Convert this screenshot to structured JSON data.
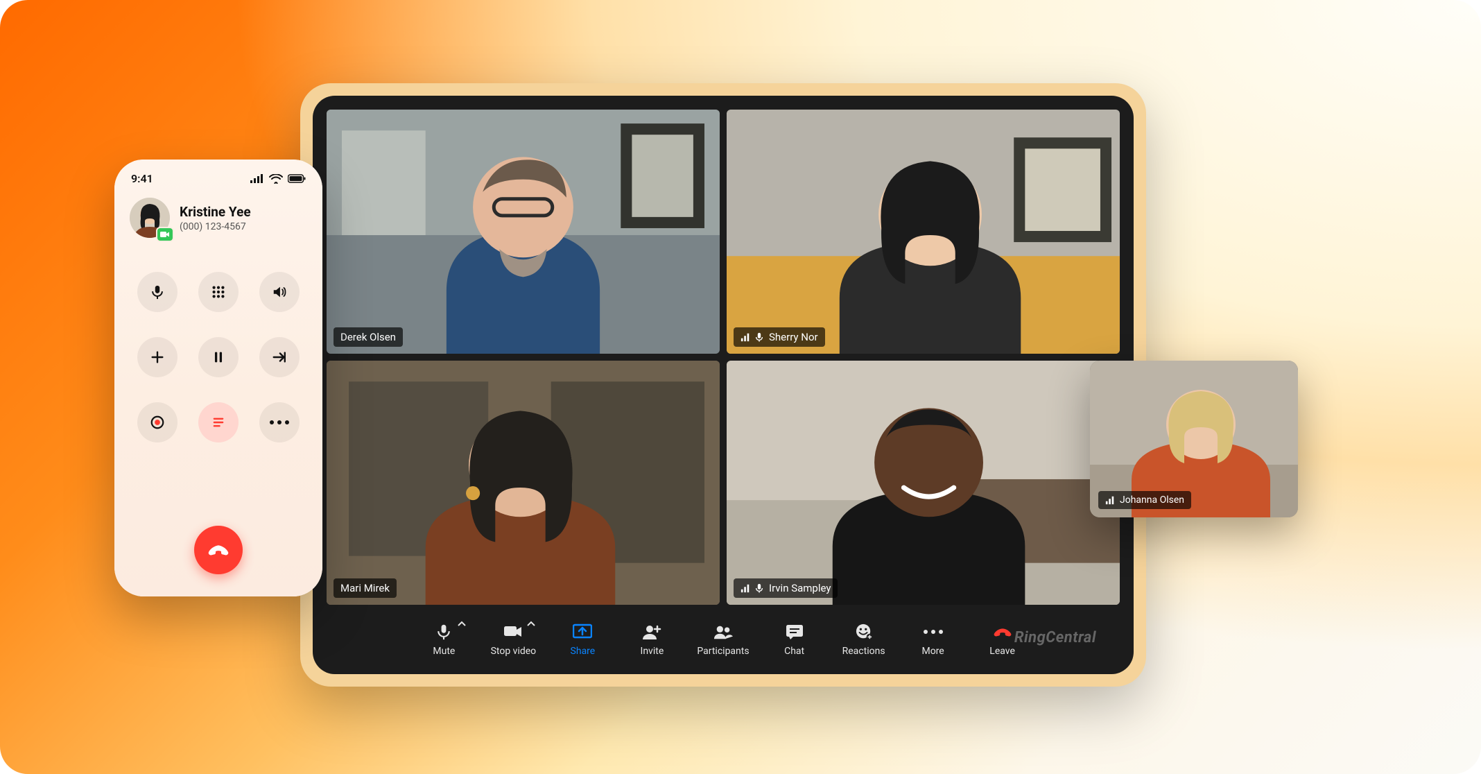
{
  "phone": {
    "status_time": "9:41",
    "caller_name": "Kristine Yee",
    "caller_number": "(000) 123-4567"
  },
  "meeting": {
    "participants": [
      {
        "name": "Derek Olsen",
        "signal": false,
        "mic": false
      },
      {
        "name": "Sherry Nor",
        "signal": true,
        "mic": true
      },
      {
        "name": "Mari Mirek",
        "signal": false,
        "mic": false
      },
      {
        "name": "Irvin Sampley",
        "signal": true,
        "mic": true
      }
    ],
    "self_view": {
      "name": "Johanna Olsen",
      "signal": true
    },
    "toolbar": {
      "mute": "Mute",
      "stop_video": "Stop video",
      "share": "Share",
      "invite": "Invite",
      "participants": "Participants",
      "chat": "Chat",
      "reactions": "Reactions",
      "more": "More",
      "leave": "Leave"
    },
    "brand": "RingCentral"
  }
}
